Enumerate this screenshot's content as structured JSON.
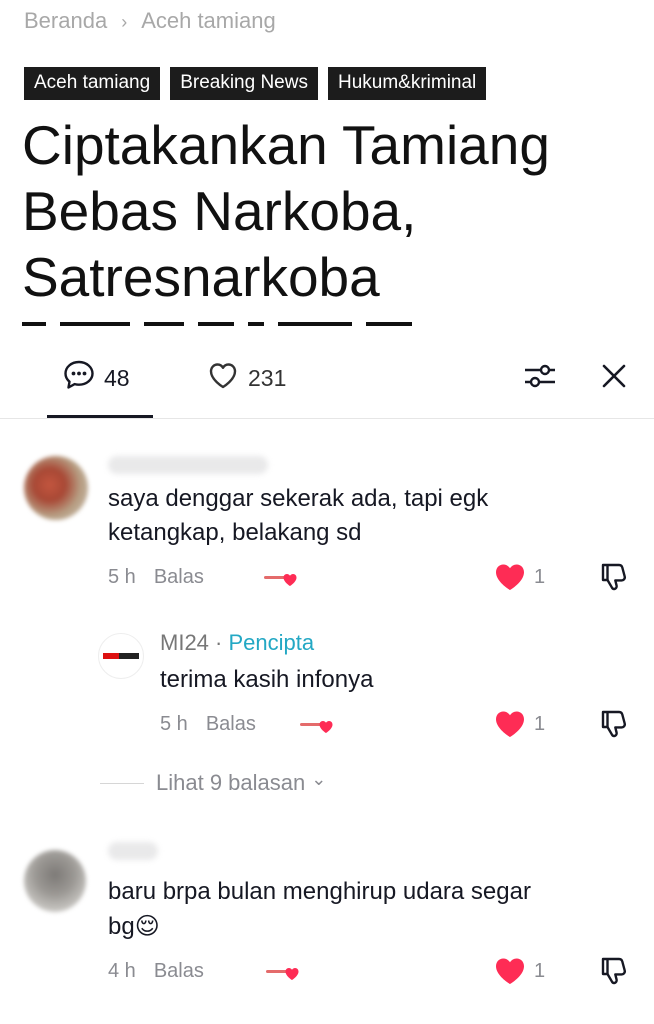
{
  "breadcrumb": {
    "home": "Beranda",
    "separator": "›",
    "current": "Aceh tamiang"
  },
  "tags": [
    "Aceh tamiang",
    "Breaking News",
    "Hukum&kriminal"
  ],
  "headline": "Ciptakankan Tamiang Bebas Narkoba, Satresnarkoba",
  "comments_panel": {
    "comment_count": "48",
    "like_count": "231",
    "icons": {
      "comments": "comment-bubble-icon",
      "likes": "heart-outline-icon",
      "filter": "sliders-icon",
      "close": "close-icon"
    },
    "accent_color": "#fe2c55",
    "creator_color": "#23a8c4"
  },
  "comments": [
    {
      "text_line1": "saya denggar sekerak ada, tapi egk",
      "text_line2": "ketangkap, belakang sd",
      "time": "5 h",
      "reply_label": "Balas",
      "likes": "1"
    },
    {
      "is_reply": true,
      "author": "MI24",
      "author_dot": "·",
      "author_badge": "Pencipta",
      "text_line1": "terima kasih infonya",
      "time": "5 h",
      "reply_label": "Balas",
      "likes": "1"
    },
    {
      "text_line1": "baru brpa bulan menghirup udara segar",
      "text_line2": "bg😌",
      "time": "4 h",
      "reply_label": "Balas",
      "likes": "1"
    }
  ],
  "view_replies": {
    "label": "Lihat 9 balasan",
    "chevron": "⌄"
  }
}
